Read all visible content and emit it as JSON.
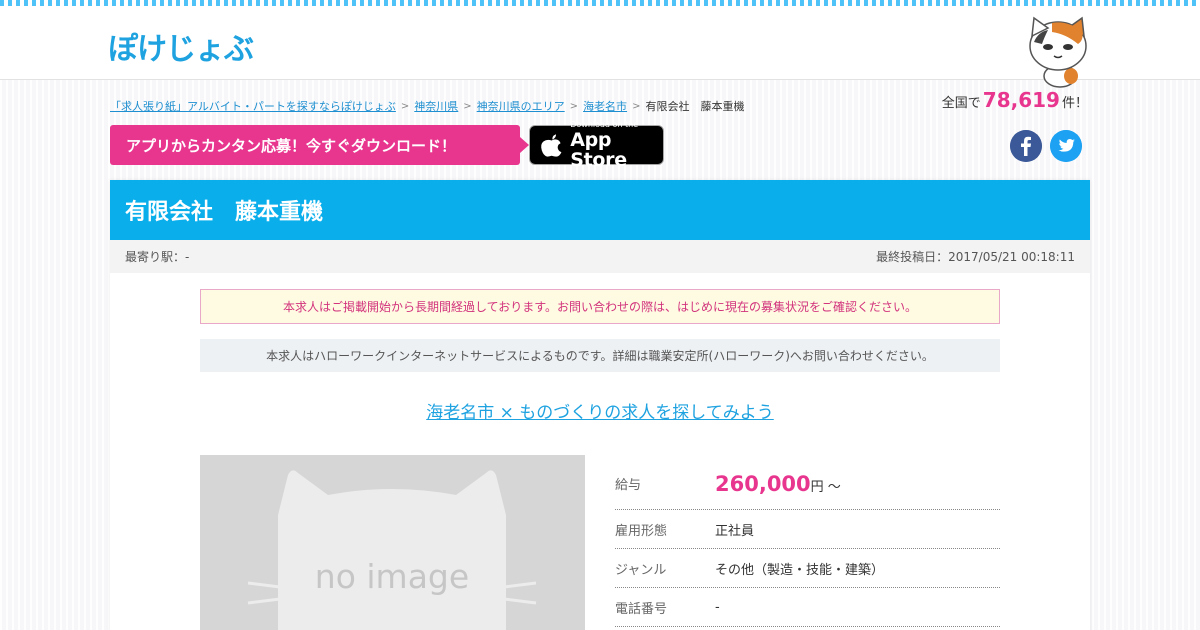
{
  "header": {
    "logo_text": "ぽけじょぶ"
  },
  "breadcrumb": {
    "items": [
      "「求人張り紙」アルバイト・パートを探すならぽけじょぶ",
      "神奈川県",
      "神奈川県のエリア",
      "海老名市"
    ],
    "current": "有限会社　藤本重機"
  },
  "count": {
    "prefix": "全国で",
    "number": "78,619",
    "suffix": "件！"
  },
  "app_banner": {
    "text": "アプリからカンタン応募！今すぐダウンロード！",
    "store_small": "Download on the",
    "store_big": "App Store"
  },
  "social": {
    "facebook": "facebook-icon",
    "twitter": "twitter-icon"
  },
  "job": {
    "title": "有限会社　藤本重機",
    "station": "最寄り駅：-",
    "posted": "最終投稿日：2017/05/21 00:18:11",
    "notice_warning": "本求人はご掲載開始から長期間経過しております。お問い合わせの際は、はじめに現在の募集状況をご確認ください。",
    "notice_source": "本求人はハローワークインターネットサービスによるものです。詳細は職業安定所(ハローワーク)へお問い合わせください。",
    "search_link": "海老名市 × ものづくりの求人を探してみよう",
    "image_text": "no image",
    "details": {
      "salary_label": "給与",
      "salary_value": "260,000",
      "salary_unit": "円 ～",
      "employment_label": "雇用形態",
      "employment_value": "正社員",
      "genre_label": "ジャンル",
      "genre_value": "その他（製造・技能・建築）",
      "phone_label": "電話番号",
      "phone_value": "-"
    }
  },
  "colors": {
    "primary_blue": "#0aaeeb",
    "accent_pink": "#e8368f",
    "link_blue": "#1e8fd0"
  }
}
